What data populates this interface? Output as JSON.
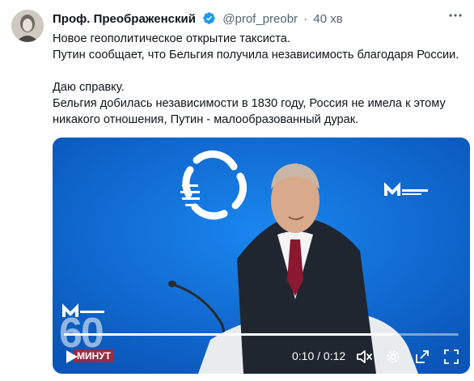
{
  "tweet": {
    "author_name": "Проф. Преображенский",
    "handle": "@prof_preobr",
    "separator": "·",
    "time": "40 хв",
    "more_icon": "more-dots-icon",
    "text_lines": [
      "Новое геополитическое открытие таксиста.",
      "Путин сообщает, что Бельгия получила независимость благодаря России.",
      "Даю справку.",
      "Бельгия добилась независимости в 1830 году, Россия не имела к этому",
      "никакого отношения, Путин - малообразованный дурак."
    ]
  },
  "video": {
    "watermark_number": "60",
    "watermark_label": "МИНУТ",
    "current_time": "0:10",
    "time_separator": "/",
    "duration": "0:12",
    "progress": 0.833,
    "accent_color": "#1d9bf0",
    "background_color": "#0a5fc9",
    "icons": [
      "play-icon",
      "mute-icon",
      "settings-icon",
      "expand-icon",
      "fullscreen-icon"
    ]
  }
}
